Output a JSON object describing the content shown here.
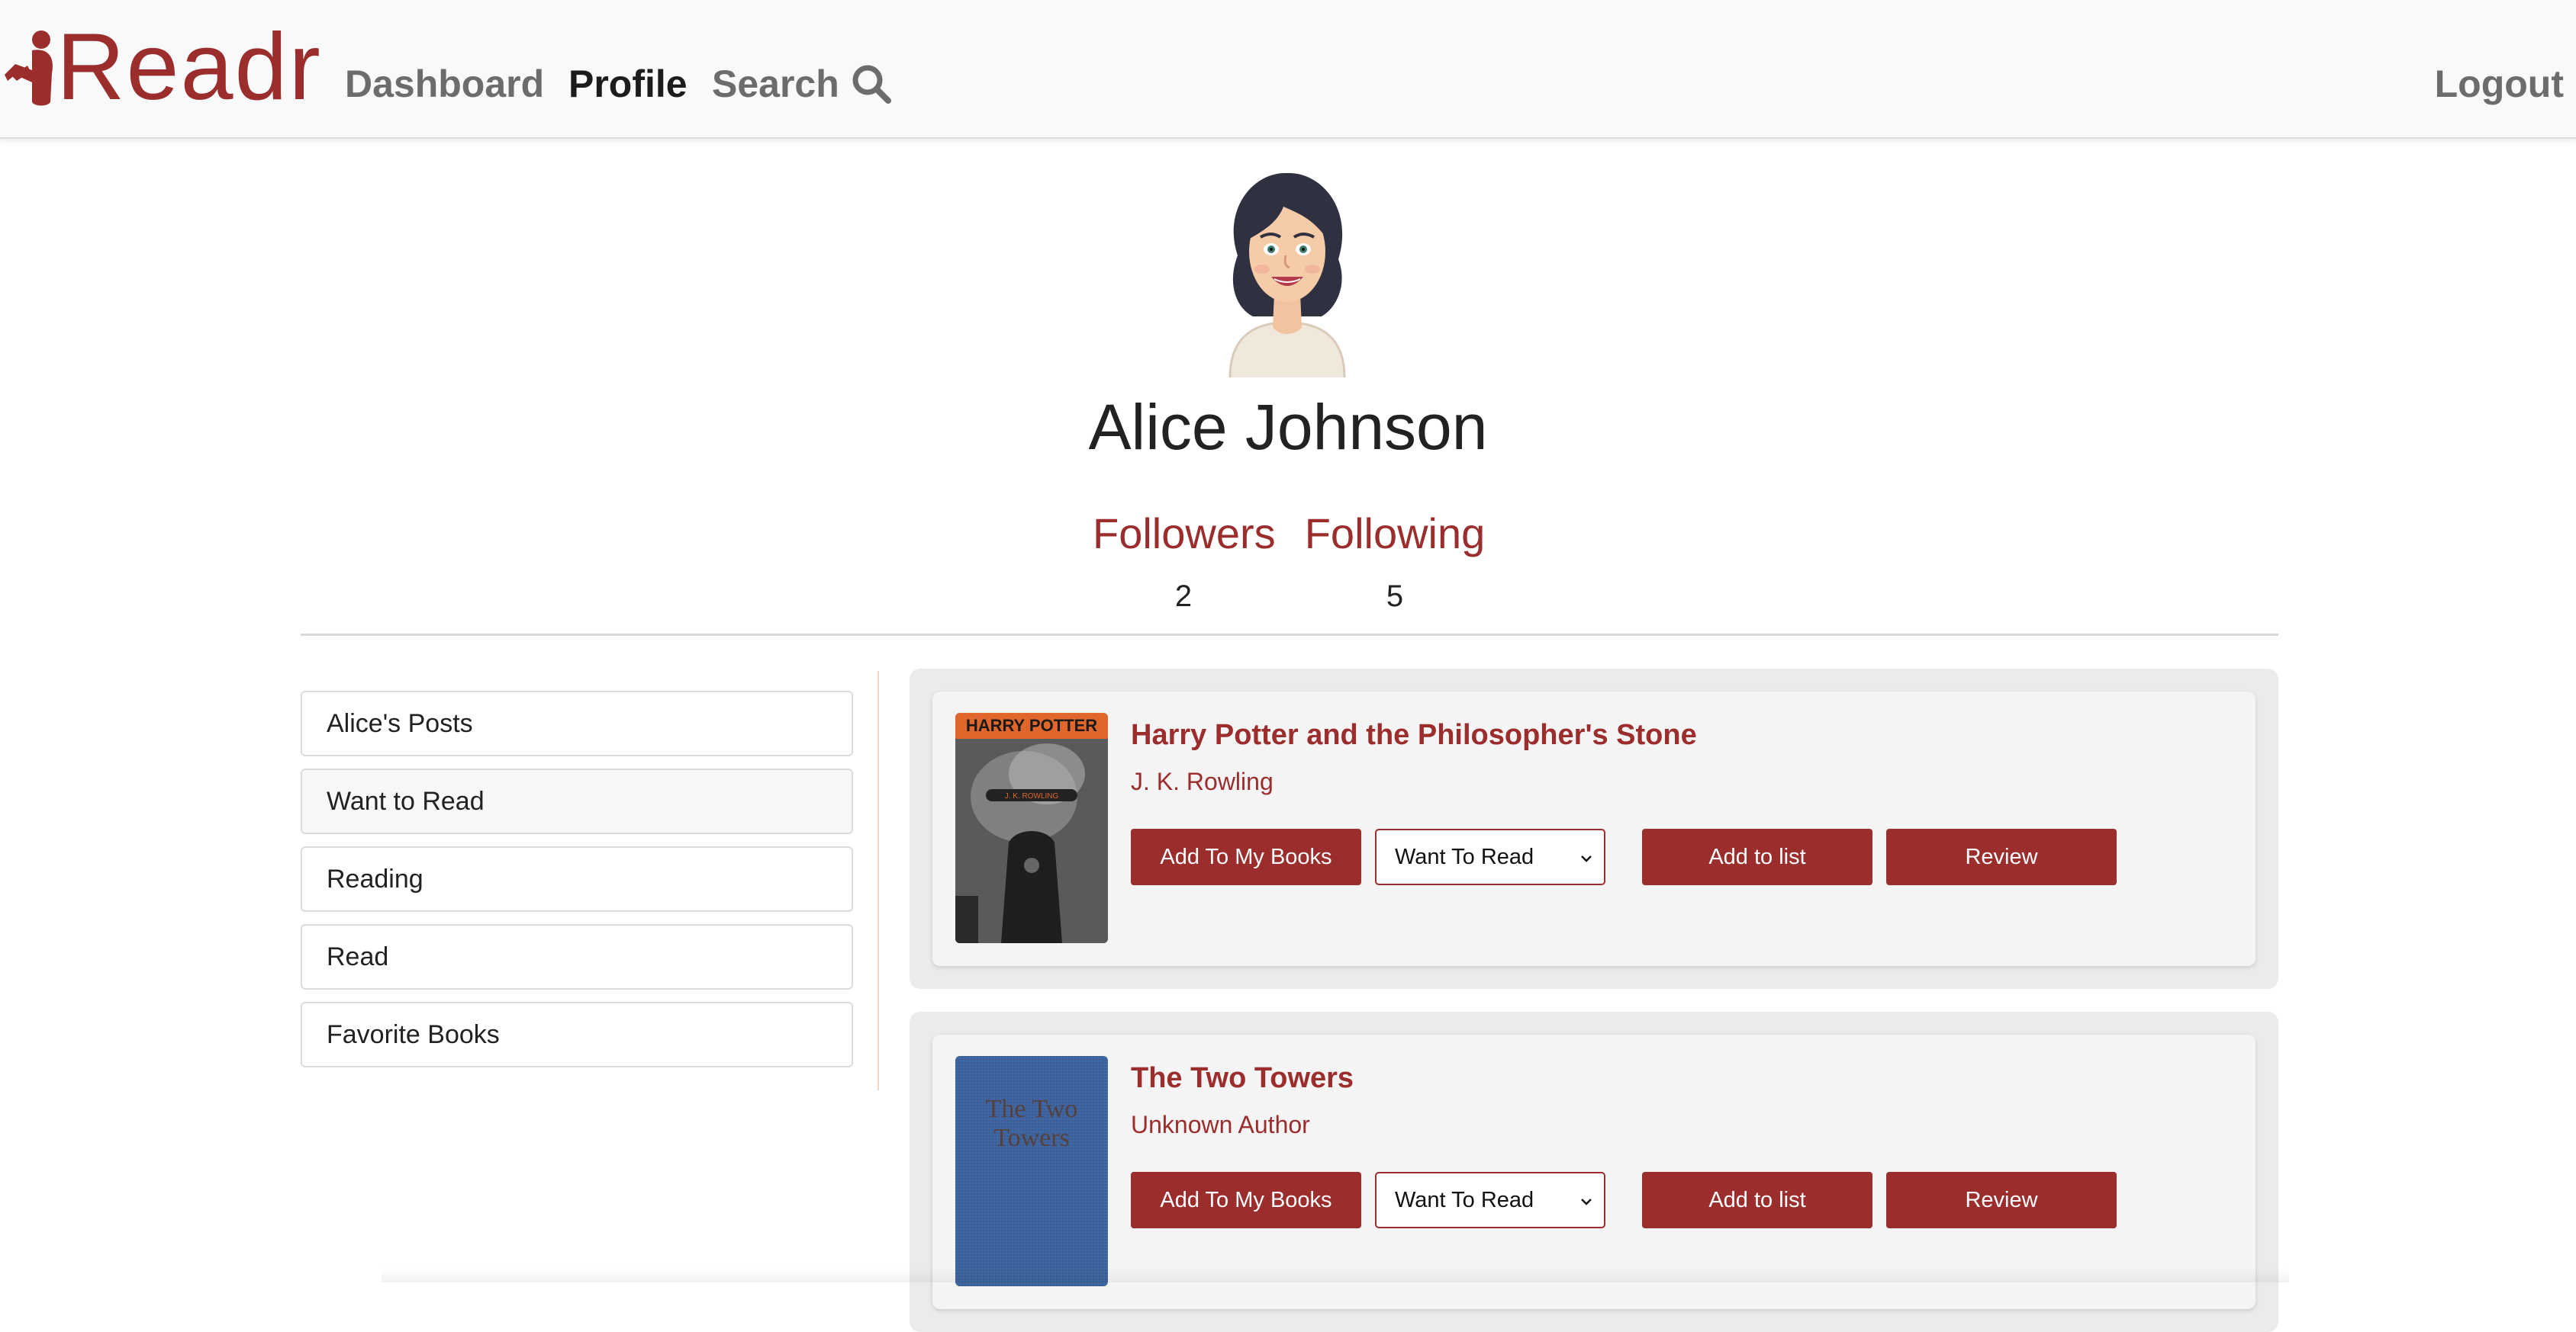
{
  "brand": {
    "name": "Readr"
  },
  "nav": {
    "dashboard": "Dashboard",
    "profile": "Profile",
    "search": "Search",
    "logout": "Logout"
  },
  "profile": {
    "name": "Alice Johnson",
    "followers_label": "Followers",
    "followers_count": "2",
    "following_label": "Following",
    "following_count": "5"
  },
  "sidebar": {
    "items": [
      {
        "label": "Alice's Posts"
      },
      {
        "label": "Want to Read",
        "active": true
      },
      {
        "label": "Reading"
      },
      {
        "label": "Read"
      },
      {
        "label": "Favorite Books"
      }
    ]
  },
  "books": [
    {
      "title": "Harry Potter and the Philosopher's Stone",
      "author": "J. K. Rowling",
      "add_label": "Add To My Books",
      "status_value": "Want To Read",
      "list_label": "Add to list",
      "review_label": "Review"
    },
    {
      "title": "The Two Towers",
      "author": "Unknown Author",
      "add_label": "Add To My Books",
      "status_value": "Want To Read",
      "list_label": "Add to list",
      "review_label": "Review"
    }
  ],
  "colors": {
    "accent": "#9b2d2d",
    "navbar_bg": "#f8f9fa",
    "card_bg": "#f4f4f4"
  }
}
